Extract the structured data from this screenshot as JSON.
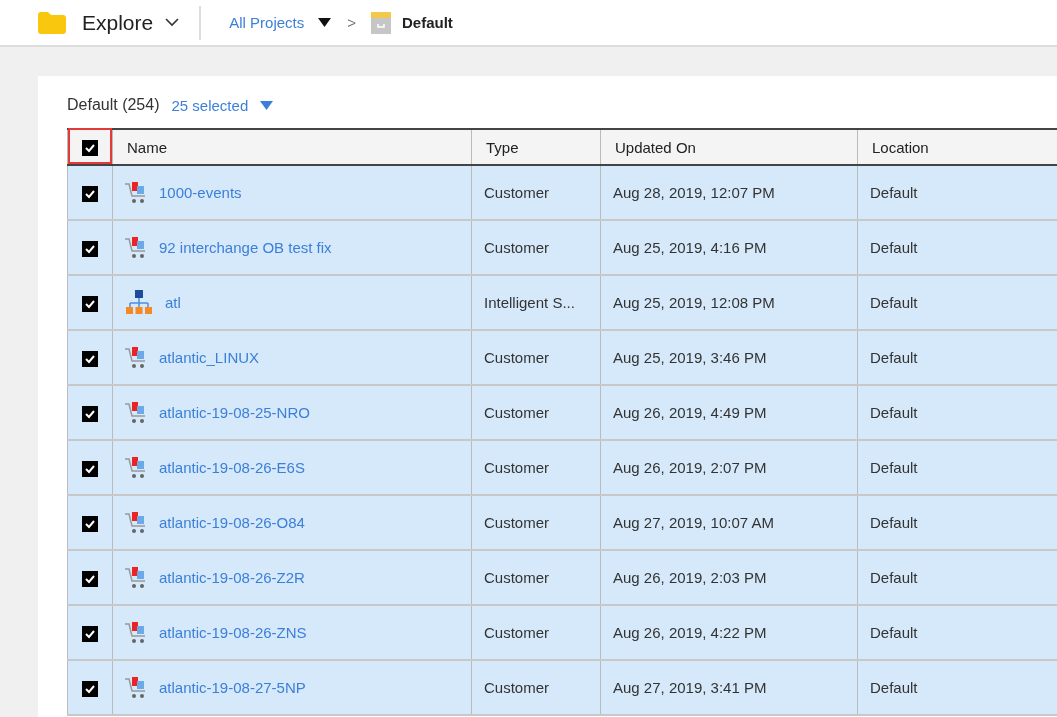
{
  "top_bar": {
    "title": "Explore",
    "breadcrumb": {
      "link": "All Projects",
      "separator": ">",
      "current": "Default"
    }
  },
  "table_header": {
    "folder": "Default (254)",
    "selection": "25 selected",
    "all_checked": true,
    "highlighted": true
  },
  "table": {
    "columns": [
      "Name",
      "Type",
      "Updated On",
      "Location"
    ],
    "rows": [
      {
        "kind": "cart",
        "name": "1000-events",
        "type": "Customer",
        "updated": "Aug 28, 2019, 12:07 PM",
        "location": "Default",
        "selected": true
      },
      {
        "kind": "cart",
        "name": "92 interchange OB test fix",
        "type": "Customer",
        "updated": "Aug 25, 2019, 4:16 PM",
        "location": "Default",
        "selected": true
      },
      {
        "kind": "hierarchy",
        "name": "atl",
        "type": "Intelligent S...",
        "updated": "Aug 25, 2019, 12:08 PM",
        "location": "Default",
        "selected": true
      },
      {
        "kind": "cart",
        "name": "atlantic_LINUX",
        "type": "Customer",
        "updated": "Aug 25, 2019, 3:46 PM",
        "location": "Default",
        "selected": true
      },
      {
        "kind": "cart",
        "name": "atlantic-19-08-25-NRO",
        "type": "Customer",
        "updated": "Aug 26, 2019, 4:49 PM",
        "location": "Default",
        "selected": true
      },
      {
        "kind": "cart",
        "name": "atlantic-19-08-26-E6S",
        "type": "Customer",
        "updated": "Aug 26, 2019, 2:07 PM",
        "location": "Default",
        "selected": true
      },
      {
        "kind": "cart",
        "name": "atlantic-19-08-26-O84",
        "type": "Customer",
        "updated": "Aug 27, 2019, 10:07 AM",
        "location": "Default",
        "selected": true
      },
      {
        "kind": "cart",
        "name": "atlantic-19-08-26-Z2R",
        "type": "Customer",
        "updated": "Aug 26, 2019, 2:03 PM",
        "location": "Default",
        "selected": true
      },
      {
        "kind": "cart",
        "name": "atlantic-19-08-26-ZNS",
        "type": "Customer",
        "updated": "Aug 26, 2019, 4:22 PM",
        "location": "Default",
        "selected": true
      },
      {
        "kind": "cart",
        "name": "atlantic-19-08-27-5NP",
        "type": "Customer",
        "updated": "Aug 27, 2019, 3:41 PM",
        "location": "Default",
        "selected": true
      }
    ]
  }
}
